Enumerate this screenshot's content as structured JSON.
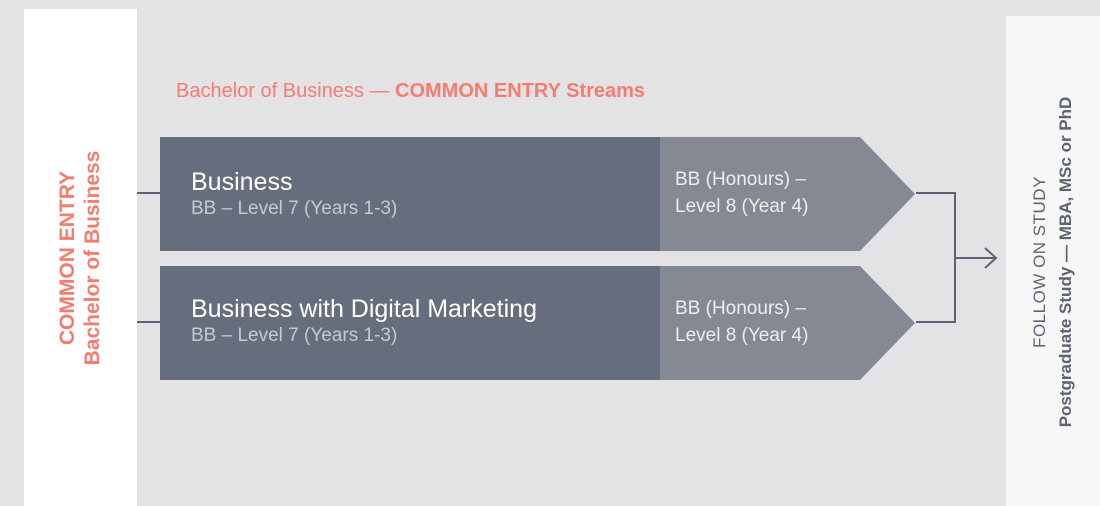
{
  "colors": {
    "accent": "#f47d72",
    "stream_dark": "#666d7c",
    "stream_light": "#858994",
    "connector": "#5d6372",
    "background": "#e3e3e6"
  },
  "left_panel": {
    "title": "COMMON ENTRY",
    "subtitle": "Bachelor of Business"
  },
  "heading": {
    "prefix": "Bachelor of Business — ",
    "strong": "COMMON ENTRY Streams"
  },
  "streams": [
    {
      "title": "Business",
      "subtitle": "BB – Level 7 (Years 1-3)",
      "honours_line1": "BB (Honours) –",
      "honours_line2": "Level 8 (Year 4)"
    },
    {
      "title": "Business with Digital Marketing",
      "subtitle": "BB – Level 7 (Years 1-3)",
      "honours_line1": "BB (Honours) –",
      "honours_line2": "Level 8 (Year 4)"
    }
  ],
  "follow_on": {
    "label": "FOLLOW ON STUDY",
    "detail": "Postgraduate Study — MBA, MSc or PhD"
  }
}
